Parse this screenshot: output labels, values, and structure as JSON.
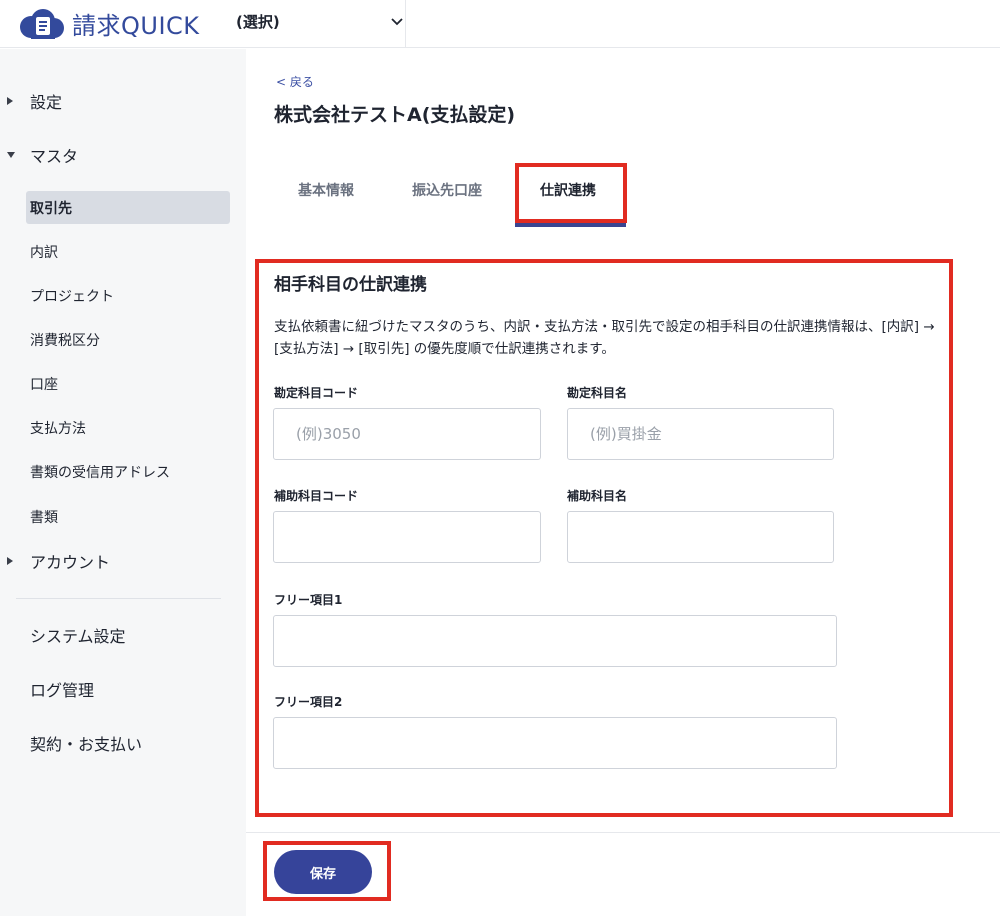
{
  "header": {
    "logo_text": "請求QUICK",
    "org_select_label": "(選択)"
  },
  "sidebar": {
    "settings": "設定",
    "master": "マスタ",
    "master_items": [
      "取引先",
      "内訳",
      "プロジェクト",
      "消費税区分",
      "口座",
      "支払方法",
      "書類の受信用アドレス",
      "書類"
    ],
    "account": "アカウント",
    "system_settings": "システム設定",
    "log_management": "ログ管理",
    "contract_payment": "契約・お支払い"
  },
  "main": {
    "back_label": "< 戻る",
    "page_title": "株式会社テストA(支払設定)",
    "tabs": [
      "基本情報",
      "振込先口座",
      "仕訳連携"
    ],
    "section_title": "相手科目の仕訳連携",
    "description": "支払依頼書に紐づけたマスタのうち、内訳・支払方法・取引先で設定の相手科目の仕訳連携情報は、[内訳] → [支払方法] → [取引先] の優先度順で仕訳連携されます。",
    "fields": {
      "account_code_label": "勘定科目コード",
      "account_code_placeholder": "(例)3050",
      "account_name_label": "勘定科目名",
      "account_name_placeholder": "(例)買掛金",
      "sub_account_code_label": "補助科目コード",
      "sub_account_name_label": "補助科目名",
      "free1_label": "フリー項目1",
      "free2_label": "フリー項目2"
    },
    "save_label": "保存"
  },
  "colors": {
    "brand": "#334a9c",
    "primary_button": "#36449a",
    "highlight": "#e12b21",
    "sidebar_bg": "#f6f7f8"
  }
}
